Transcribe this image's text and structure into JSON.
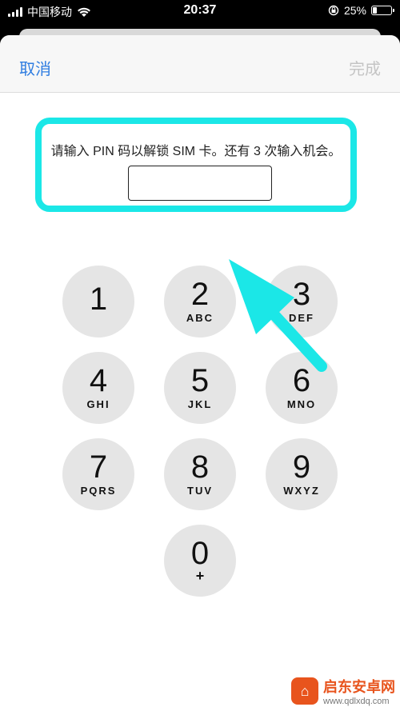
{
  "status_bar": {
    "carrier": "中国移动",
    "time": "20:37",
    "battery": "25%",
    "battery_level": 0.25
  },
  "nav": {
    "cancel_label": "取消",
    "done_label": "完成"
  },
  "prompt": {
    "text": "请输入 PIN 码以解锁 SIM 卡。还有 3 次输入机会。",
    "pin_value": ""
  },
  "keypad": {
    "keys": [
      {
        "digit": "1",
        "letters": ""
      },
      {
        "digit": "2",
        "letters": "ABC"
      },
      {
        "digit": "3",
        "letters": "DEF"
      },
      {
        "digit": "4",
        "letters": "GHI"
      },
      {
        "digit": "5",
        "letters": "JKL"
      },
      {
        "digit": "6",
        "letters": "MNO"
      },
      {
        "digit": "7",
        "letters": "PQRS"
      },
      {
        "digit": "8",
        "letters": "TUV"
      },
      {
        "digit": "9",
        "letters": "WXYZ"
      },
      {
        "digit": "0",
        "letters": "+"
      }
    ]
  },
  "watermark": {
    "name": "启东安卓网",
    "url": "www.qdlxdq.com"
  },
  "colors": {
    "accent": "#2f7de1",
    "highlight": "#1be7e7",
    "disabled": "#c4c4c4",
    "key_bg": "#e5e5e5"
  },
  "icons": [
    "signal-icon",
    "wifi-icon",
    "rotation-lock-icon",
    "battery-icon",
    "arrow-annotation-icon"
  ]
}
